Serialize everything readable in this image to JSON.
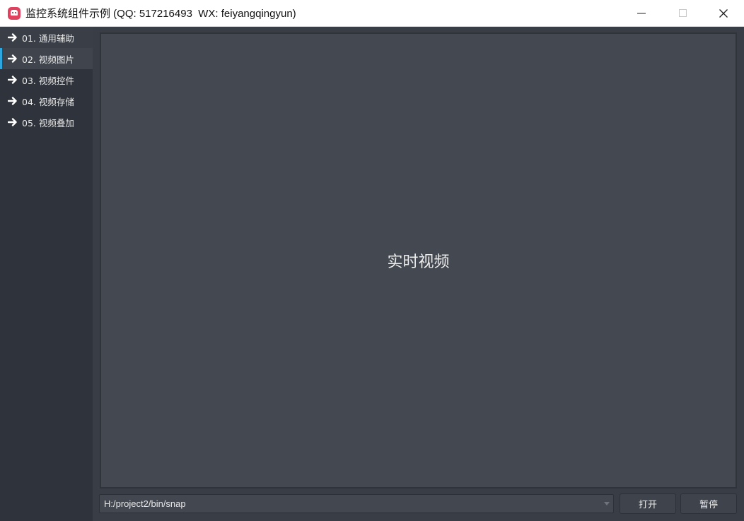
{
  "window": {
    "title": "监控系统组件示例 (QQ: 517216493  WX: feiyangqingyun)",
    "controls": [
      "minimize",
      "maximize",
      "close"
    ]
  },
  "nav": {
    "items": [
      {
        "label": "01. 通用辅助",
        "active": false
      },
      {
        "label": "02. 视频图片",
        "active": true
      },
      {
        "label": "03. 视频控件",
        "active": false
      },
      {
        "label": "04. 视频存储",
        "active": false
      },
      {
        "label": "05. 视频叠加",
        "active": false
      }
    ]
  },
  "main": {
    "video_label": "实时视频",
    "path_value": "H:/project2/bin/snap",
    "open_label": "打开",
    "pause_label": "暂停"
  },
  "colors": {
    "accent": "#2ea7e0",
    "app_icon": "#e0415e",
    "video_bg": "#444851"
  }
}
